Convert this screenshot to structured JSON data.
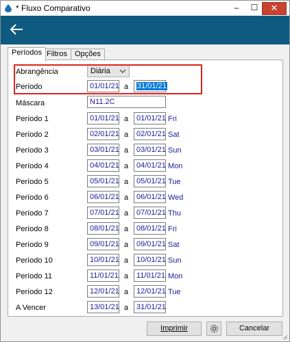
{
  "window": {
    "title": "* Fluxo Comparativo",
    "minimize": "–",
    "maximize": "☐",
    "close": "✕"
  },
  "tabs": [
    "Períodos",
    "Filtros",
    "Opções"
  ],
  "form": {
    "abrangencia_label": "Abrangência",
    "abrangencia_value": "Diária",
    "periodo_label": "Período",
    "periodo_from": "01/01/21",
    "periodo_sep": "a",
    "periodo_to": "31/01/21",
    "mascara_label": "Máscara",
    "mascara_value": "N11.2C"
  },
  "periods": [
    {
      "label": "Período 1",
      "from": "01/01/21",
      "sep": "a",
      "to": "01/01/21",
      "dow": "Fri"
    },
    {
      "label": "Período 2",
      "from": "02/01/21",
      "sep": "a",
      "to": "02/01/21",
      "dow": "Sat"
    },
    {
      "label": "Período 3",
      "from": "03/01/21",
      "sep": "a",
      "to": "03/01/21",
      "dow": "Sun"
    },
    {
      "label": "Período 4",
      "from": "04/01/21",
      "sep": "a",
      "to": "04/01/21",
      "dow": "Mon"
    },
    {
      "label": "Período 5",
      "from": "05/01/21",
      "sep": "a",
      "to": "05/01/21",
      "dow": "Tue"
    },
    {
      "label": "Período 6",
      "from": "06/01/21",
      "sep": "a",
      "to": "06/01/21",
      "dow": "Wed"
    },
    {
      "label": "Período 7",
      "from": "07/01/21",
      "sep": "a",
      "to": "07/01/21",
      "dow": "Thu"
    },
    {
      "label": "Período 8",
      "from": "08/01/21",
      "sep": "a",
      "to": "08/01/21",
      "dow": "Fri"
    },
    {
      "label": "Período 9",
      "from": "09/01/21",
      "sep": "a",
      "to": "09/01/21",
      "dow": "Sat"
    },
    {
      "label": "Período 10",
      "from": "10/01/21",
      "sep": "a",
      "to": "10/01/21",
      "dow": "Sun"
    },
    {
      "label": "Período 11",
      "from": "11/01/21",
      "sep": "a",
      "to": "11/01/21",
      "dow": "Mon"
    },
    {
      "label": "Período 12",
      "from": "12/01/21",
      "sep": "a",
      "to": "12/01/21",
      "dow": "Tue"
    },
    {
      "label": "A Vencer",
      "from": "13/01/21",
      "sep": "a",
      "to": "31/01/21",
      "dow": ""
    }
  ],
  "buttons": {
    "print": "Imprimir",
    "cancel": "Cancelar"
  },
  "colors": {
    "navbar": "#0e5a80",
    "field_text": "#1a1a9a",
    "highlight": "#e0211b",
    "selection": "#0078d7"
  }
}
